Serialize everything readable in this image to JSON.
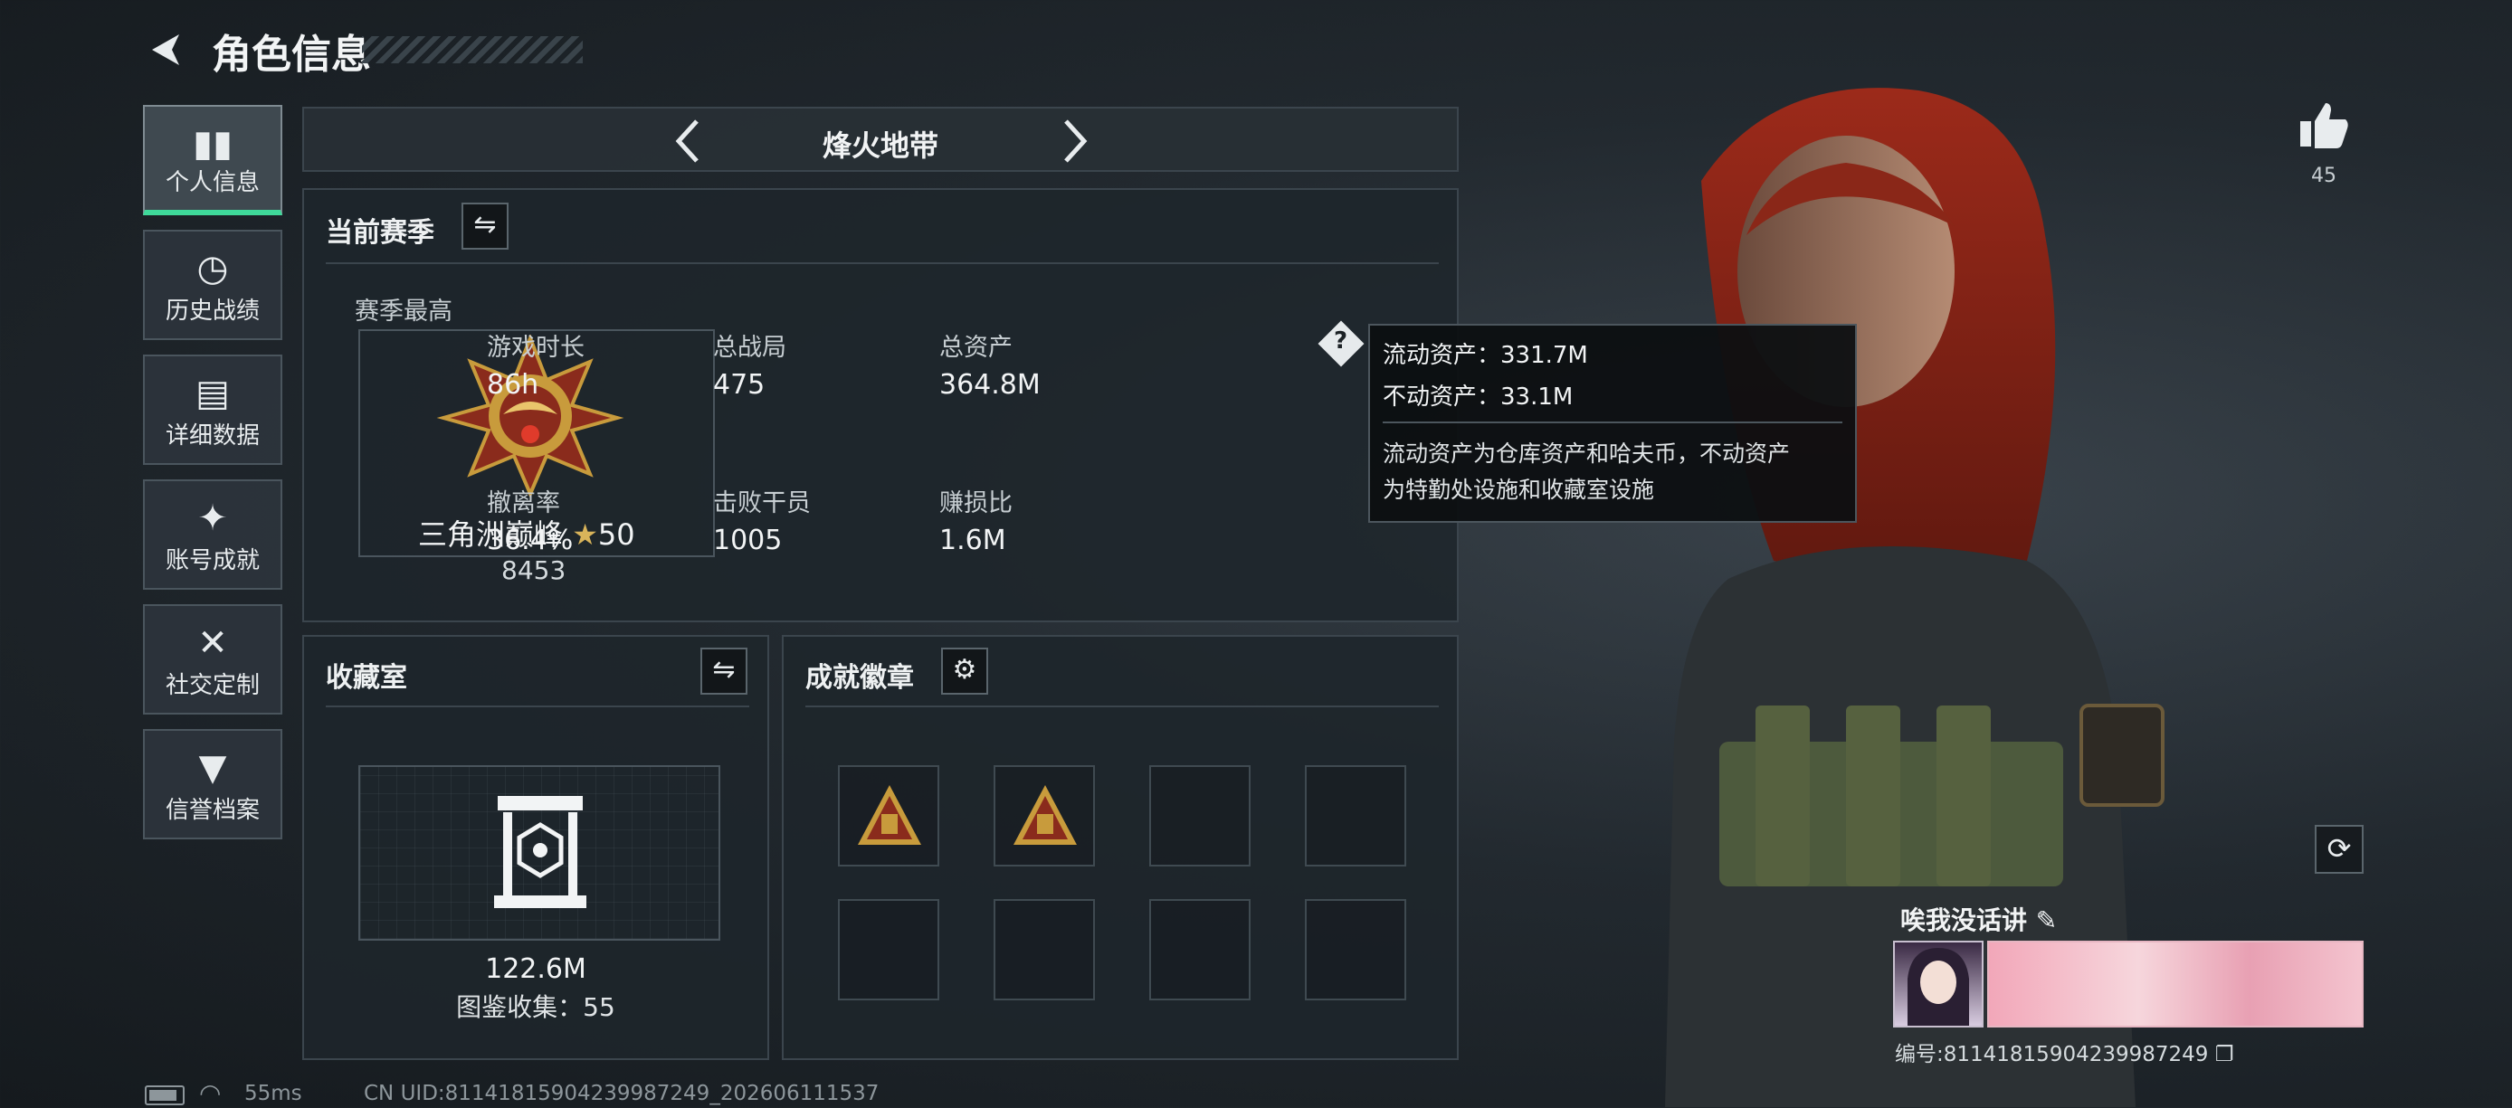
{
  "header": {
    "title": "角色信息",
    "back_icon": "back-arrow-icon"
  },
  "nav": [
    {
      "label": "个人信息",
      "icon": "bar-chart-icon",
      "active": true
    },
    {
      "label": "历史战绩",
      "icon": "clock-icon",
      "active": false
    },
    {
      "label": "详细数据",
      "icon": "folder-icon",
      "active": false
    },
    {
      "label": "账号成就",
      "icon": "achievement-icon",
      "active": false
    },
    {
      "label": "社交定制",
      "icon": "tools-icon",
      "active": false
    },
    {
      "label": "信誉档案",
      "icon": "shield-icon",
      "active": false
    }
  ],
  "mode": {
    "title": "烽火地带"
  },
  "season": {
    "title": "当前赛季",
    "best_label": "赛季最高",
    "rank_name": "三角洲巅峰",
    "rank_stars": "50",
    "rank_points": "8453",
    "stats": [
      {
        "label": "游戏时长",
        "value": "86h"
      },
      {
        "label": "总战局",
        "value": "475"
      },
      {
        "label": "总资产",
        "value": "364.8M"
      },
      {
        "label": "撤离率",
        "value": "36.4%"
      },
      {
        "label": "击败干员",
        "value": "1005"
      },
      {
        "label": "赚损比",
        "value": "1.6M"
      }
    ]
  },
  "tooltip": {
    "line1": "流动资产：331.7M",
    "line2": "不动资产：33.1M",
    "desc_line1": "流动资产为仓库资产和哈夫币，不动资产",
    "desc_line2": "为特勤处设施和收藏室设施"
  },
  "collection": {
    "title": "收藏室",
    "value": "122.6M",
    "count_label": "图鉴收集：55"
  },
  "badges": {
    "title": "成就徽章",
    "filled": 2,
    "total": 8
  },
  "likes": {
    "count": "45"
  },
  "player": {
    "name": "唉我没话讲",
    "id_text": "编号:8114181590423998724​9"
  },
  "status": {
    "ping": "55ms",
    "uid": "CN UID:8114181590423998724​9_202606111537"
  },
  "colors": {
    "accent": "#3fd99a",
    "gold": "#c89b3c",
    "badge_red": "#8a2b1c"
  }
}
